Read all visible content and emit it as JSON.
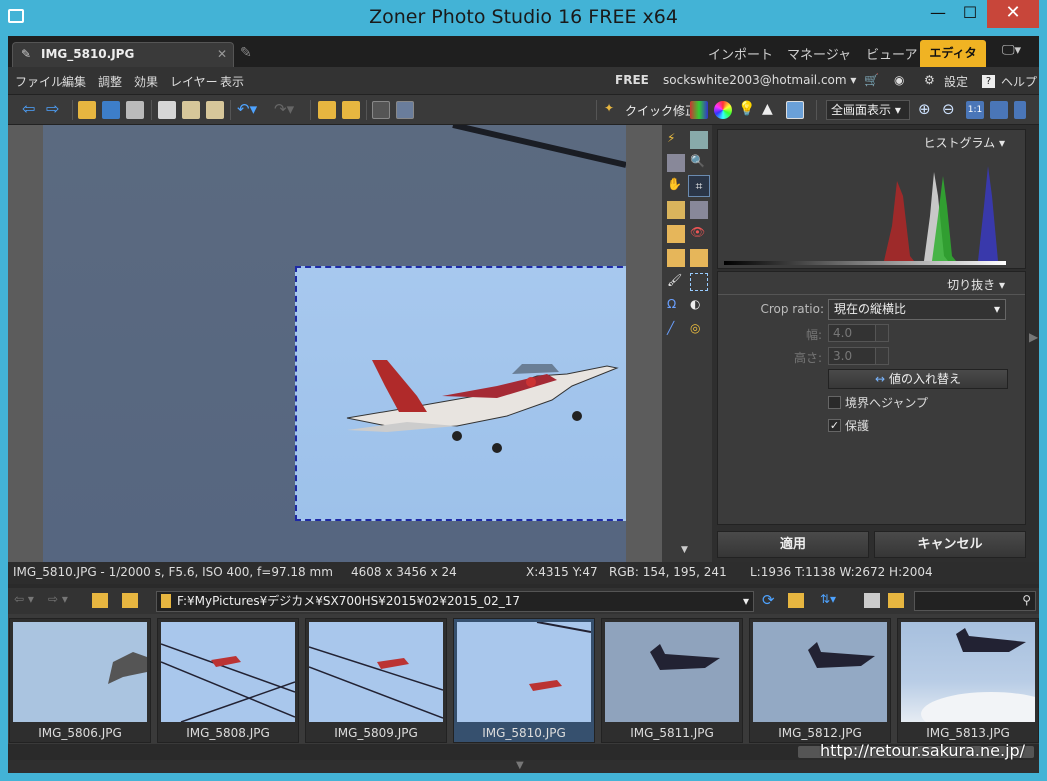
{
  "window": {
    "title": "Zoner Photo Studio 16 FREE x64"
  },
  "tabs": {
    "document": "IMG_5810.JPG"
  },
  "modes": [
    "インポート",
    "マネージャ",
    "ビューア",
    "エディタ"
  ],
  "menu": [
    "ファイル",
    "編集",
    "調整",
    "効果",
    "レイヤー",
    "表示"
  ],
  "account": {
    "edition": "FREE",
    "email": "sockswhite2003@hotmail.com ▾",
    "settings": "設定",
    "help": "ヘルプ"
  },
  "toolbar": {
    "quick_fix": "クイック修正",
    "zoom_mode": "全画面表示"
  },
  "histogram": {
    "title": "ヒストグラム ▾"
  },
  "crop": {
    "title": "切り抜き ▾",
    "ratio_label": "Crop ratio:",
    "ratio_value": "現在の縦横比",
    "width_label": "幅:",
    "width_value": "4.0",
    "height_label": "高さ:",
    "height_value": "3.0",
    "swap_label": "値の入れ替え",
    "jump_label": "境界へジャンプ",
    "protect_label": "保護"
  },
  "actions": {
    "apply": "適用",
    "cancel": "キャンセル"
  },
  "status": {
    "info": "IMG_5810.JPG - 1/2000 s, F5.6, ISO 400, f=97.18 mm",
    "size": "4608 x 3456 x 24",
    "coords": "X:4315 Y:47",
    "rgb": "RGB: 154, 195, 241",
    "crop_box": "L:1936  T:1138  W:2672  H:2004"
  },
  "browser": {
    "path": "F:¥MyPictures¥デジカメ¥SX700HS¥2015¥02¥2015_02_17"
  },
  "thumbnails": [
    {
      "name": "IMG_5806.JPG"
    },
    {
      "name": "IMG_5808.JPG"
    },
    {
      "name": "IMG_5809.JPG"
    },
    {
      "name": "IMG_5810.JPG"
    },
    {
      "name": "IMG_5811.JPG"
    },
    {
      "name": "IMG_5812.JPG"
    },
    {
      "name": "IMG_5813.JPG"
    }
  ],
  "watermark": "http://retour.sakura.ne.jp/"
}
